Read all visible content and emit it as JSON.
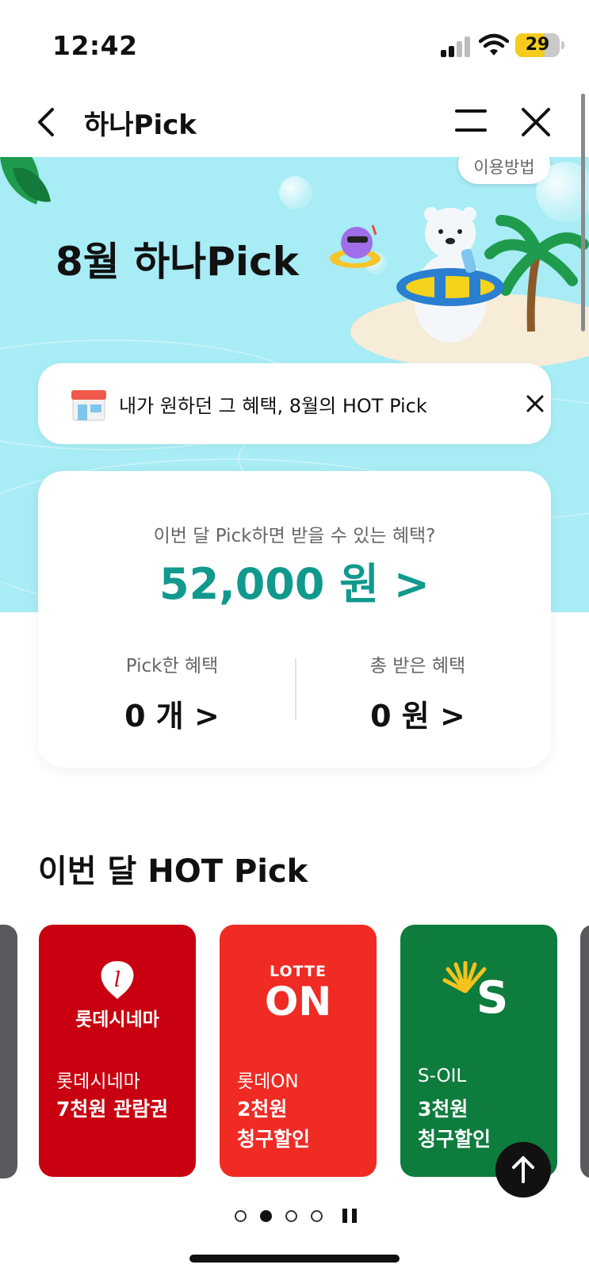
{
  "status_bar": {
    "time": "12:42",
    "battery": "29",
    "battery_color": "#f5cc1c"
  },
  "nav": {
    "title": "하나Pick",
    "back_icon": "chevron-left-icon",
    "menu_icon": "menu-icon",
    "close_icon": "close-icon"
  },
  "hero": {
    "usage_label": "이용방법",
    "title": "8월 하나Pick",
    "background_color": "#a8ecf5"
  },
  "notice": {
    "text": "내가 원하던 그 혜택, 8월의 HOT Pick",
    "icon": "shop-icon"
  },
  "summary": {
    "question": "이번 달 Pick하면 받을 수 있는 혜택?",
    "amount": "52,000 원  >",
    "amount_color": "#11998e",
    "picked_label": "Pick한 혜택",
    "picked_value": "0 개  >",
    "received_label": "총 받은 혜택",
    "received_value": "0 원  >"
  },
  "hot_pick": {
    "title": "이번 달 HOT Pick",
    "cards": [
      {
        "brand": "롯데시네마",
        "benefit": "7천원 관람권",
        "logo_text": "롯데시네마",
        "color": "#c8000f"
      },
      {
        "brand": "롯데ON",
        "benefit": "2천원\n청구할인",
        "logo_top": "LOTTE",
        "logo_main": "ON",
        "color": "#ef2b24"
      },
      {
        "brand": "S-OIL",
        "benefit": "3천원\n청구할인",
        "logo_main": "S",
        "color": "#0d7c3d"
      }
    ]
  },
  "pagination": {
    "count": 4,
    "active_index": 1
  }
}
